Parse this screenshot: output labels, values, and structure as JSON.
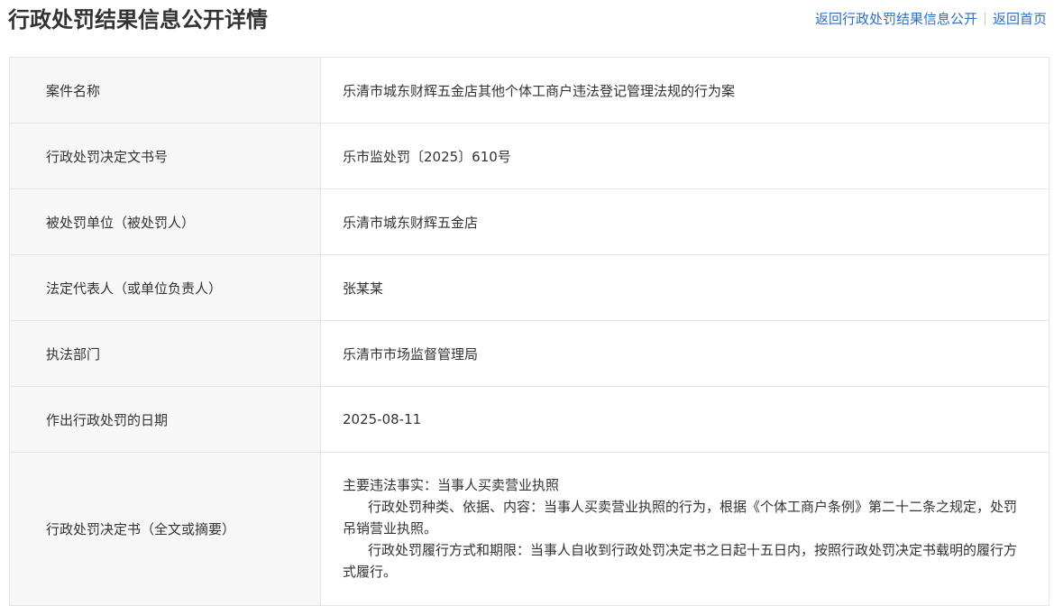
{
  "header": {
    "title": "行政处罚结果信息公开详情",
    "links": {
      "back_to_list": "返回行政处罚结果信息公开",
      "back_home": "返回首页"
    }
  },
  "details": {
    "case_name": {
      "label": "案件名称",
      "value": "乐清市城东财辉五金店其他个体工商户违法登记管理法规的行为案"
    },
    "decision_number": {
      "label": "行政处罚决定文书号",
      "value": "乐市监处罚〔2025〕610号"
    },
    "penalized_party": {
      "label": "被处罚单位（被处罚人）",
      "value": "乐清市城东财辉五金店"
    },
    "legal_representative": {
      "label": "法定代表人（或单位负责人）",
      "value": "张某某"
    },
    "enforcement_department": {
      "label": "执法部门",
      "value": "乐清市市场监督管理局"
    },
    "decision_date": {
      "label": "作出行政处罚的日期",
      "value": "2025-08-11"
    },
    "decision_text": {
      "label": "行政处罚决定书（全文或摘要）",
      "paragraphs": [
        "主要违法事实：当事人买卖营业执照",
        "行政处罚种类、依据、内容：当事人买卖营业执照的行为，根据《个体工商户条例》第二十二条之规定，处罚吊销营业执照。",
        "行政处罚履行方式和期限：当事人自收到行政处罚决定书之日起十五日内，按照行政处罚决定书载明的履行方式履行。"
      ]
    }
  }
}
